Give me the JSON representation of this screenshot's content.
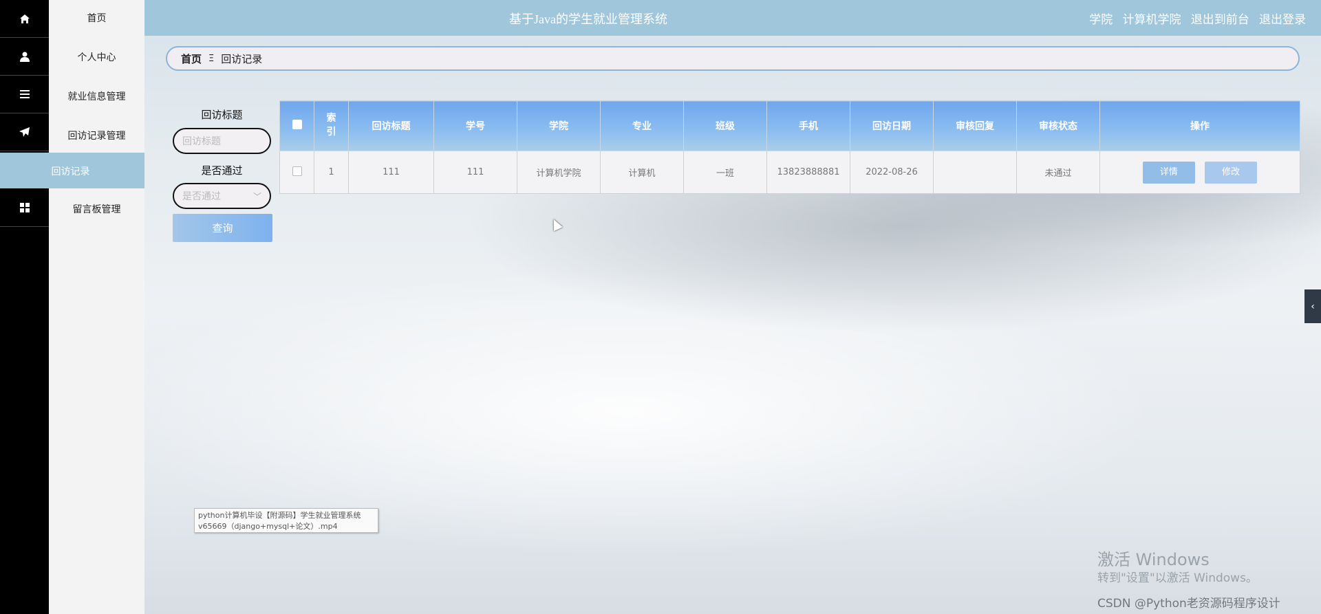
{
  "app": {
    "title": "基于Java的学生就业管理系统",
    "header_links": [
      "学院",
      "计算机学院",
      "退出到前台",
      "退出登录"
    ]
  },
  "sidebar": {
    "items": [
      {
        "label": "首页",
        "icon": "home-icon"
      },
      {
        "label": "个人中心",
        "icon": "user-icon"
      },
      {
        "label": "就业信息管理",
        "icon": "list-icon"
      },
      {
        "label": "回访记录管理",
        "icon": "send-icon"
      },
      {
        "label": "回访记录",
        "icon": "",
        "active": true
      },
      {
        "label": "留言板管理",
        "icon": "grid-icon"
      }
    ]
  },
  "breadcrumb": {
    "home": "首页",
    "separator": "Ξ",
    "current": "回访记录"
  },
  "search": {
    "title_label": "回访标题",
    "title_placeholder": "回访标题",
    "pass_label": "是否通过",
    "pass_placeholder": "是否通过",
    "button": "查询"
  },
  "table": {
    "columns": [
      "索引",
      "回访标题",
      "学号",
      "学院",
      "专业",
      "班级",
      "手机",
      "回访日期",
      "审核回复",
      "审核状态",
      "操作"
    ],
    "rows": [
      {
        "index": "1",
        "title": "111",
        "student_no": "111",
        "college": "计算机学院",
        "major": "计算机",
        "class": "一班",
        "phone": "13823888881",
        "date": "2022-08-26",
        "reply": "",
        "status": "未通过",
        "actions": [
          "详情",
          "修改"
        ]
      }
    ]
  },
  "overlays": {
    "tooltip_line1": "python计算机毕设【附源码】学生就业管理系统",
    "tooltip_line2": "v65669（django+mysql+论文）.mp4",
    "watermark_title": "激活 Windows",
    "watermark_sub": "转到\"设置\"以激活 Windows。",
    "csdn": "CSDN @Python老资源码程序设计"
  },
  "colors": {
    "header": "#9fc6da",
    "table_header": "#7eb2ee",
    "sidebar_dark": "#000000"
  }
}
